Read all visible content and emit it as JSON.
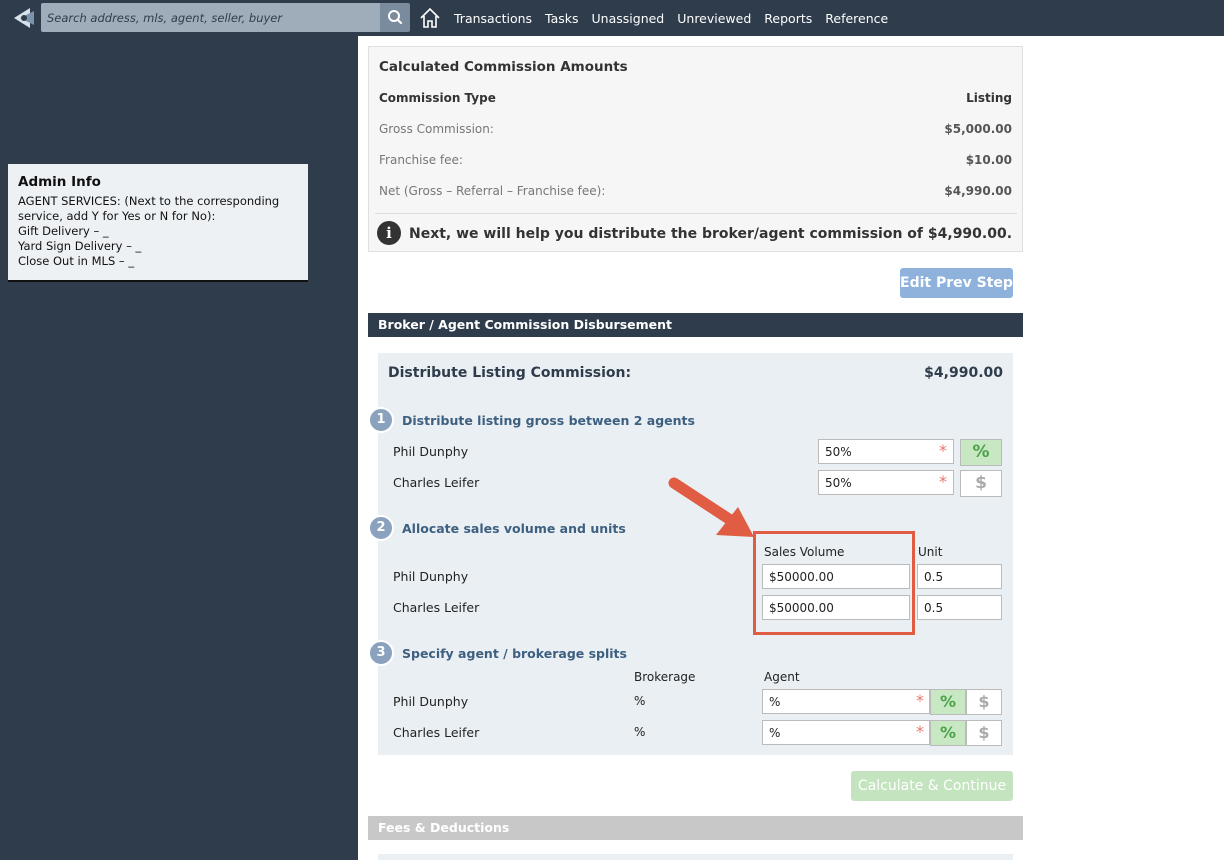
{
  "header": {
    "search_placeholder": "Search address, mls, agent, seller, buyer",
    "nav": [
      "Transactions",
      "Tasks",
      "Unassigned",
      "Unreviewed",
      "Reports",
      "Reference"
    ]
  },
  "admin": {
    "title": "Admin Info",
    "lines": [
      "AGENT SERVICES: (Next to the corresponding",
      "service, add Y for Yes or N for No):",
      "Gift Delivery – _",
      "Yard Sign Delivery – _",
      "Close Out in MLS – _"
    ]
  },
  "calc": {
    "title": "Calculated Commission Amounts",
    "header_label": "Commission Type",
    "header_value": "Listing",
    "rows": [
      {
        "label": "Gross Commission:",
        "value": "$5,000.00"
      },
      {
        "label": "Franchise fee:",
        "value": "$10.00"
      },
      {
        "label": "Net (Gross – Referral – Franchise fee):",
        "value": "$4,990.00"
      }
    ],
    "info_icon_glyph": "i",
    "info": "Next, we will help you distribute the broker/agent commission of $4,990.00."
  },
  "buttons": {
    "edit_prev": "Edit Prev Step",
    "calculate": "Calculate & Continue"
  },
  "disbursement": {
    "section_title": "Broker / Agent Commission Disbursement",
    "panel_title": "Distribute Listing Commission:",
    "panel_amount": "$4,990.00",
    "steps": [
      {
        "num": "1",
        "label": "Distribute listing gross between 2 agents"
      },
      {
        "num": "2",
        "label": "Allocate sales volume and units"
      },
      {
        "num": "3",
        "label": "Specify agent / brokerage splits"
      }
    ],
    "agents": [
      "Phil Dunphy",
      "Charles Leifer"
    ],
    "split_values": [
      "50%",
      "50%"
    ],
    "volume_header": "Sales Volume",
    "unit_header": "Unit",
    "volumes": [
      "$50000.00",
      "$50000.00"
    ],
    "units": [
      "0.5",
      "0.5"
    ],
    "brokerage_header": "Brokerage",
    "agent_header": "Agent",
    "brokerage_values": [
      "%",
      "%"
    ],
    "agent_values": [
      "%",
      "%"
    ],
    "required_mark": "*",
    "percent_glyph": "%",
    "dollar_glyph": "$"
  },
  "fees": {
    "section_title": "Fees & Deductions"
  },
  "colors": {
    "topbar": "#2e3c4c",
    "accent_green": "#4ca24a",
    "highlight": "#e05c43"
  }
}
